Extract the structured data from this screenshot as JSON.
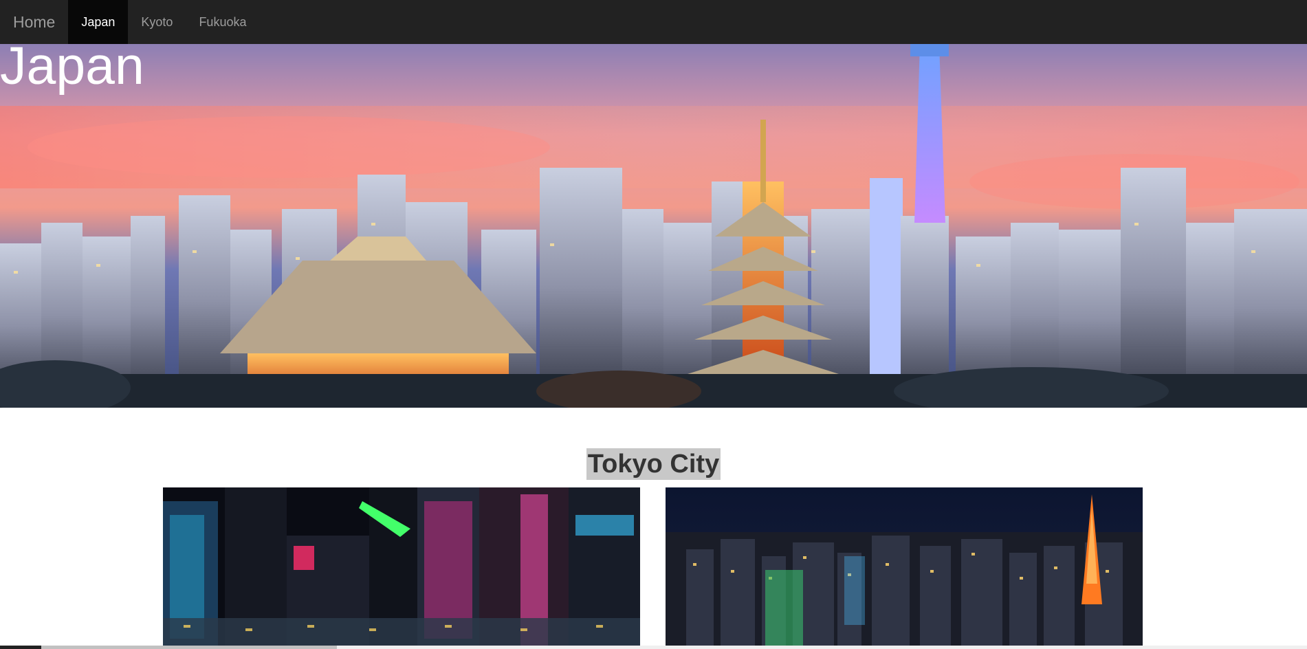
{
  "navbar": {
    "brand": "Home",
    "items": [
      {
        "label": "Japan",
        "active": true
      },
      {
        "label": "Kyoto",
        "active": false
      },
      {
        "label": "Fukuoka",
        "active": false
      }
    ]
  },
  "hero": {
    "title": "Japan"
  },
  "section": {
    "heading": "Tokyo City"
  },
  "colors": {
    "navbar_bg": "#222222",
    "nav_active_bg": "#080808",
    "nav_text": "#9d9d9d",
    "heading_highlight": "#c8c8c8"
  }
}
